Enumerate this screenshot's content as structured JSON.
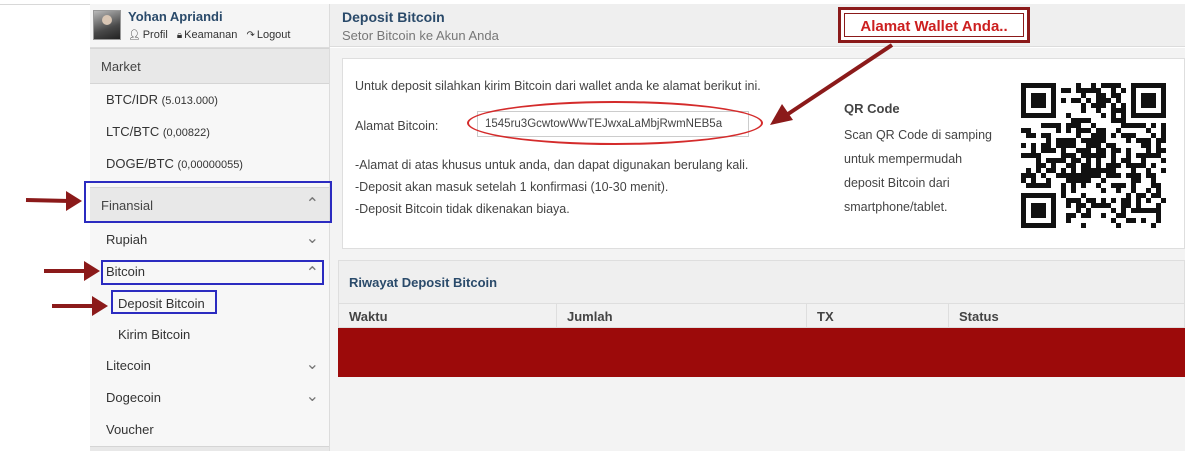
{
  "user": {
    "name": "Yohan Apriandi",
    "links": [
      "Profil",
      "Keamanan",
      "Logout"
    ]
  },
  "sidebar": {
    "market_header": "Market",
    "markets": [
      {
        "pair": "BTC/IDR",
        "price": "(5.013.000)"
      },
      {
        "pair": "LTC/BTC",
        "price": "(0,00822)"
      },
      {
        "pair": "DOGE/BTC",
        "price": "(0,00000055)"
      }
    ],
    "finansial_header": "Finansial",
    "items": {
      "rupiah": "Rupiah",
      "bitcoin": "Bitcoin",
      "deposit_bitcoin": "Deposit Bitcoin",
      "kirim_bitcoin": "Kirim Bitcoin",
      "litecoin": "Litecoin",
      "dogecoin": "Dogecoin",
      "voucher": "Voucher"
    }
  },
  "page": {
    "title": "Deposit Bitcoin",
    "subtitle": "Setor Bitcoin ke Akun Anda"
  },
  "deposit": {
    "intro": "Untuk deposit silahkan kirim Bitcoin dari wallet anda ke alamat berikut ini.",
    "address_label": "Alamat Bitcoin:",
    "address_value": "1545ru3GcwtowWwTEJwxaLaMbjRwmNEB5a",
    "notes": [
      "-Alamat di atas khusus untuk anda, dan dapat digunakan berulang kali.",
      "-Deposit akan masuk setelah 1 konfirmasi (10-30 menit).",
      "-Deposit Bitcoin tidak dikenakan biaya."
    ],
    "qr_title": "QR Code",
    "qr_desc": "Scan QR Code di samping untuk mempermudah deposit Bitcoin dari smartphone/tablet."
  },
  "history": {
    "title": "Riwayat Deposit Bitcoin",
    "columns": [
      "Waktu",
      "Jumlah",
      "TX",
      "Status"
    ]
  },
  "annotation": {
    "callout": "Alamat Wallet Anda..",
    "color": "#8b1a1a"
  }
}
